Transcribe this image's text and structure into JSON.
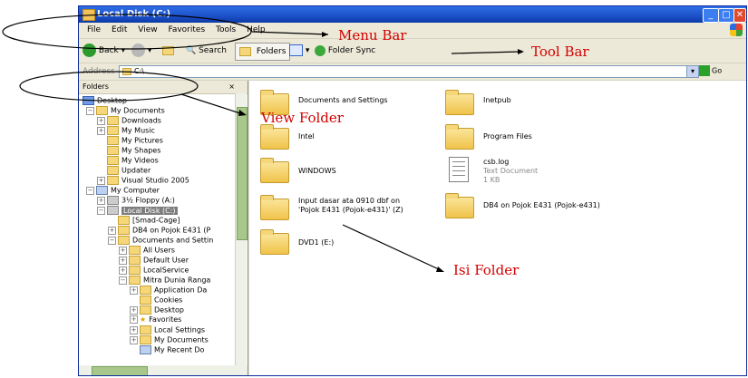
{
  "window": {
    "title": "Local Disk (C:)"
  },
  "menu": [
    "File",
    "Edit",
    "View",
    "Favorites",
    "Tools",
    "Help"
  ],
  "toolbar": {
    "back": "Back",
    "search": "Search",
    "folders": "Folders",
    "folder_sync": "Folder Sync"
  },
  "address": {
    "label": "Address",
    "value": "C:\\",
    "go": "Go"
  },
  "folders_pane": {
    "title": "Folders",
    "close": "×",
    "items": [
      {
        "label": "Desktop"
      },
      {
        "label": "My Documents"
      },
      {
        "label": "Downloads"
      },
      {
        "label": "My Music"
      },
      {
        "label": "My Pictures"
      },
      {
        "label": "My Shapes"
      },
      {
        "label": "My Videos"
      },
      {
        "label": "Updater"
      },
      {
        "label": "Visual Studio 2005"
      },
      {
        "label": "My Computer"
      },
      {
        "label": "3½ Floppy (A:)"
      },
      {
        "label": "Local Disk (C:)"
      },
      {
        "label": "[Smad-Cage]"
      },
      {
        "label": "DB4 on Pojok E431 (P"
      },
      {
        "label": "Documents and Settin"
      },
      {
        "label": "All Users"
      },
      {
        "label": "Default User"
      },
      {
        "label": "LocalService"
      },
      {
        "label": "Mitra Dunia Ranga"
      },
      {
        "label": "Application Da"
      },
      {
        "label": "Cookies"
      },
      {
        "label": "Desktop"
      },
      {
        "label": "Favorites"
      },
      {
        "label": "Local Settings"
      },
      {
        "label": "My Documents"
      },
      {
        "label": "My Recent Do"
      }
    ]
  },
  "content": {
    "items": [
      {
        "name": "Documents and Settings"
      },
      {
        "name": "Inetpub"
      },
      {
        "name": "Intel"
      },
      {
        "name": "Program Files"
      },
      {
        "name": "WINDOWS"
      },
      {
        "name": "csb.log",
        "type": "Text Document",
        "size": "1 KB"
      },
      {
        "name": "Input dasar ata 0910 dbf on",
        "name2": "'Pojok E431 (Pojok-e431)' (Z)"
      },
      {
        "name": "DB4 on Pojok E431 (Pojok-e431)"
      },
      {
        "name": "DVD1 (E:)"
      }
    ]
  },
  "annotations": {
    "menu_bar": "Menu Bar",
    "tool_bar": "Tool Bar",
    "view_folder": "View Folder",
    "isi_folder": "Isi Folder"
  },
  "colors": {
    "annotation": "#d40000",
    "titlebar": "#1d50c8",
    "folder": "#f0c34a"
  }
}
